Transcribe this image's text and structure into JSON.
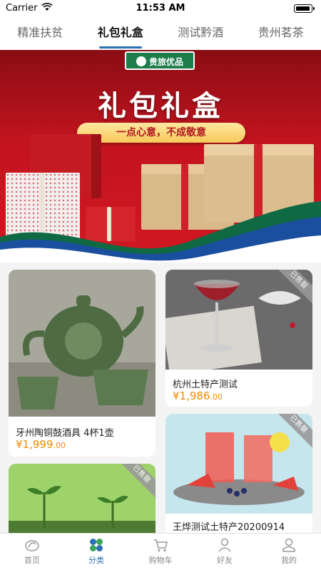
{
  "status_bar": {
    "carrier": "Carrier",
    "time": "11:53 AM"
  },
  "tabs": [
    {
      "label": "精准扶贫",
      "active": false
    },
    {
      "label": "礼包礼盒",
      "active": true
    },
    {
      "label": "测试黔酒",
      "active": false
    },
    {
      "label": "贵州茗茶",
      "active": false
    }
  ],
  "banner": {
    "logo_text": "贵旅优品",
    "title": "礼包礼盒",
    "slogan": "一点心意，不成敬意"
  },
  "products": [
    {
      "name": "牙州陶铜鼓酒具 4杯1壶",
      "currency": "¥",
      "price_int": "1,999",
      "price_dec": ".00",
      "sold_out": false
    },
    {
      "name": "杭州土特产测试",
      "currency": "¥",
      "price_int": "1,986",
      "price_dec": ".00",
      "sold_out": true,
      "sold_label": "已售罄"
    },
    {
      "name": "王烨测试土特产20200914",
      "sold_out": true,
      "sold_label": "已售罄"
    },
    {
      "name": "",
      "sold_out": true,
      "sold_label": "已售罄"
    }
  ],
  "bottom_nav": [
    {
      "label": "首页",
      "icon": "home-icon",
      "active": false
    },
    {
      "label": "分类",
      "icon": "category-icon",
      "active": true
    },
    {
      "label": "购物车",
      "icon": "cart-icon",
      "active": false
    },
    {
      "label": "好友",
      "icon": "friends-icon",
      "active": false
    },
    {
      "label": "我的",
      "icon": "profile-icon",
      "active": false
    }
  ],
  "colors": {
    "accent": "#2b6fb3",
    "price": "#f08a00",
    "banner_red": "#c4141f"
  }
}
